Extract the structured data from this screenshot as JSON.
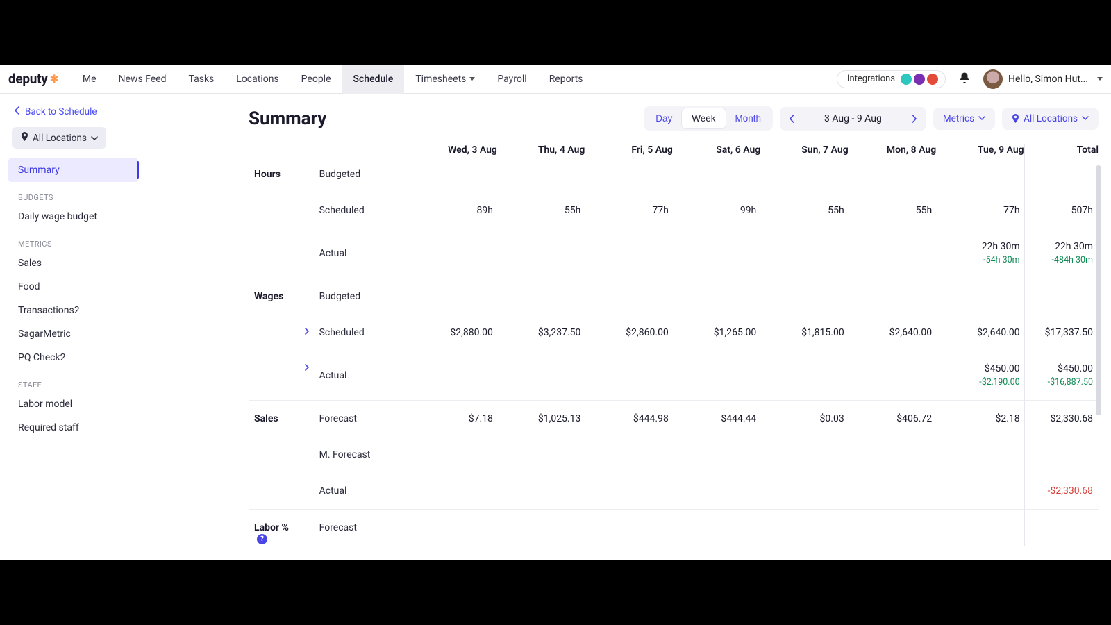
{
  "nav": {
    "brand": "deputy",
    "items": [
      "Me",
      "News Feed",
      "Tasks",
      "Locations",
      "People",
      "Schedule",
      "Timesheets",
      "Payroll",
      "Reports"
    ],
    "active": "Schedule",
    "integrations_label": "Integrations",
    "user_greeting": "Hello, Simon Hut..."
  },
  "sidebar": {
    "back_label": "Back to Schedule",
    "location_label": "All Locations",
    "active": "Summary",
    "summary_label": "Summary",
    "groups": [
      {
        "heading": "BUDGETS",
        "items": [
          "Daily wage budget"
        ]
      },
      {
        "heading": "METRICS",
        "items": [
          "Sales",
          "Food",
          "Transactions2",
          "SagarMetric",
          "PQ Check2"
        ]
      },
      {
        "heading": "STAFF",
        "items": [
          "Labor model",
          "Required staff"
        ]
      }
    ]
  },
  "header": {
    "title": "Summary",
    "segments": [
      "Day",
      "Week",
      "Month"
    ],
    "segment_active": "Week",
    "date_range": "3 Aug - 9 Aug",
    "metrics_label": "Metrics",
    "locations_label": "All Locations"
  },
  "columns": [
    "Wed, 3 Aug",
    "Thu, 4 Aug",
    "Fri, 5 Aug",
    "Sat, 6 Aug",
    "Sun, 7 Aug",
    "Mon, 8 Aug",
    "Tue, 9 Aug"
  ],
  "total_label": "Total",
  "sections": [
    {
      "group": "Hours",
      "rows": [
        {
          "label": "Budgeted",
          "cells": [
            "",
            "",
            "",
            "",
            "",
            "",
            ""
          ],
          "total": ""
        },
        {
          "label": "Scheduled",
          "cells": [
            "89h",
            "55h",
            "77h",
            "99h",
            "55h",
            "55h",
            "77h"
          ],
          "total": "507h"
        },
        {
          "label": "Actual",
          "cells": [
            "",
            "",
            "",
            "",
            "",
            "",
            "22h 30m"
          ],
          "cells_sub": [
            "",
            "",
            "",
            "",
            "",
            "",
            "-54h 30m"
          ],
          "total": "22h 30m",
          "total_sub": "-484h 30m",
          "sub_class": "pos"
        }
      ]
    },
    {
      "group": "Wages",
      "rows": [
        {
          "label": "Budgeted",
          "cells": [
            "",
            "",
            "",
            "",
            "",
            "",
            ""
          ],
          "total": ""
        },
        {
          "label": "Scheduled",
          "expandable": true,
          "cells": [
            "$2,880.00",
            "$3,237.50",
            "$2,860.00",
            "$1,265.00",
            "$1,815.00",
            "$2,640.00",
            "$2,640.00"
          ],
          "total": "$17,337.50"
        },
        {
          "label": "Actual",
          "expandable": true,
          "cells": [
            "",
            "",
            "",
            "",
            "",
            "",
            "$450.00"
          ],
          "cells_sub": [
            "",
            "",
            "",
            "",
            "",
            "",
            "-$2,190.00"
          ],
          "total": "$450.00",
          "total_sub": "-$16,887.50",
          "sub_class": "pos"
        }
      ]
    },
    {
      "group": "Sales",
      "rows": [
        {
          "label": "Forecast",
          "cells": [
            "$7.18",
            "$1,025.13",
            "$444.98",
            "$444.44",
            "$0.03",
            "$406.72",
            "$2.18"
          ],
          "total": "$2,330.68"
        },
        {
          "label": "M. Forecast",
          "cells": [
            "",
            "",
            "",
            "",
            "",
            "",
            ""
          ],
          "total": ""
        },
        {
          "label": "Actual",
          "cells": [
            "",
            "",
            "",
            "",
            "",
            "",
            ""
          ],
          "total": "-$2,330.68",
          "total_class": "neg"
        }
      ]
    },
    {
      "group": "Labor %",
      "group_help": true,
      "rows": [
        {
          "label": "Forecast",
          "cells": [
            "",
            "",
            "",
            "",
            "",
            "",
            ""
          ],
          "total": ""
        }
      ]
    }
  ]
}
